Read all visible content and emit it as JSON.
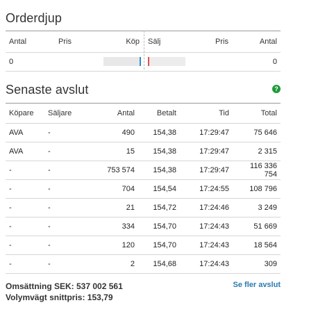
{
  "orderbook": {
    "title": "Orderdjup",
    "headers": {
      "antal_left": "Antal",
      "pris_left": "Pris",
      "buy": "Köp",
      "sell": "Sälj",
      "pris_right": "Pris",
      "antal_right": "Antal"
    },
    "row": {
      "antal_left": "0",
      "antal_right": "0"
    },
    "colors": {
      "buy": "#2a8dd4",
      "sell": "#e0524b"
    }
  },
  "trades": {
    "title": "Senaste avslut",
    "help_icon": "question-icon",
    "headers": {
      "buyer": "Köpare",
      "seller": "Säljare",
      "qty": "Antal",
      "price": "Betalt",
      "time": "Tid",
      "total": "Total"
    },
    "rows": [
      {
        "buyer": "AVA",
        "seller": "-",
        "qty": "490",
        "price": "154,38",
        "time": "17:29:47",
        "total": "75 646"
      },
      {
        "buyer": "AVA",
        "seller": "-",
        "qty": "15",
        "price": "154,38",
        "time": "17:29:47",
        "total": "2 315"
      },
      {
        "buyer": "-",
        "seller": "-",
        "qty": "753 574",
        "price": "154,38",
        "time": "17:29:47",
        "total": "116 336 754"
      },
      {
        "buyer": "-",
        "seller": "-",
        "qty": "704",
        "price": "154,54",
        "time": "17:24:55",
        "total": "108 796"
      },
      {
        "buyer": "-",
        "seller": "-",
        "qty": "21",
        "price": "154,72",
        "time": "17:24:46",
        "total": "3 249"
      },
      {
        "buyer": "-",
        "seller": "-",
        "qty": "334",
        "price": "154,70",
        "time": "17:24:43",
        "total": "51 669"
      },
      {
        "buyer": "-",
        "seller": "-",
        "qty": "120",
        "price": "154,70",
        "time": "17:24:43",
        "total": "18 564"
      },
      {
        "buyer": "-",
        "seller": "-",
        "qty": "2",
        "price": "154,68",
        "time": "17:24:43",
        "total": "309"
      }
    ]
  },
  "summary": {
    "turnover": "Omsättning SEK: 537 002 561",
    "vwap": "Volymvägt snittpris: 153,79"
  },
  "more_link": "Se fler avslut"
}
